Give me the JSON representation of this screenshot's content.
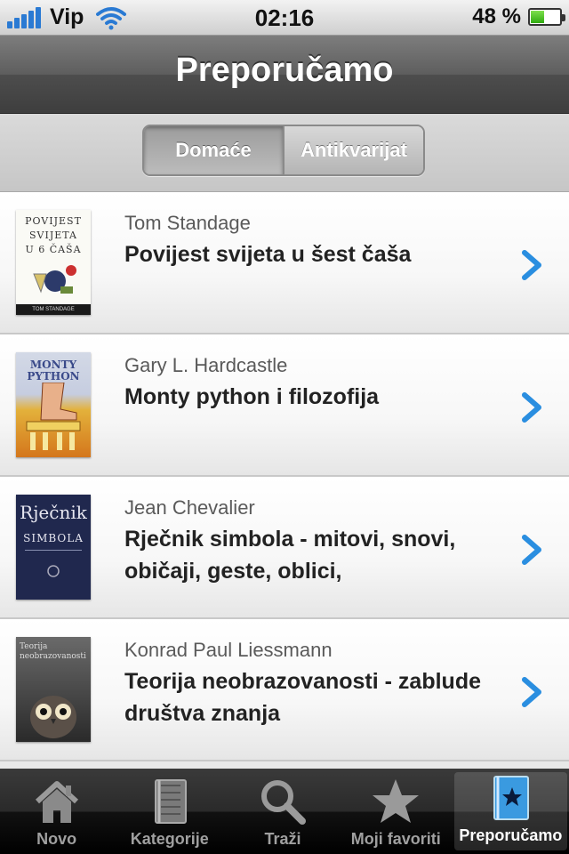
{
  "status_bar": {
    "carrier": "Vip",
    "time": "02:16",
    "battery": "48 %",
    "battery_level": 0.48
  },
  "nav": {
    "title": "Preporučamo"
  },
  "segments": {
    "items": [
      "Domaće",
      "Antikvarijat"
    ],
    "selected": 0
  },
  "books": [
    {
      "author": "Tom Standage",
      "title": "Povijest svijeta u šest čaša",
      "cover_lines": [
        "POVIJEST",
        "SVIJETA",
        "U 6 ČAŠA"
      ],
      "cover_byline": "TOM STANDAGE"
    },
    {
      "author": "Gary L. Hardcastle",
      "title": "Monty python i filozofija",
      "cover_lines": [
        "MONTY",
        "PYTHON"
      ],
      "cover_byline": ""
    },
    {
      "author": "Jean Chevalier",
      "title": "Rječnik simbola - mitovi, snovi, običaji, geste, oblici,",
      "cover_lines": [
        "Rječnik",
        "SIMBOLA"
      ],
      "cover_byline": ""
    },
    {
      "author": "Konrad Paul Liessmann",
      "title": "Teorija neobrazovanosti - zablude društva znanja",
      "cover_lines": [
        "Teorija",
        "neobrazovanosti"
      ],
      "cover_byline": ""
    }
  ],
  "tabs": [
    {
      "label": "Novo",
      "icon": "home-icon"
    },
    {
      "label": "Kategorije",
      "icon": "notebook-icon"
    },
    {
      "label": "Traži",
      "icon": "search-icon"
    },
    {
      "label": "Moji favoriti",
      "icon": "star-icon"
    },
    {
      "label": "Preporučamo",
      "icon": "recommend-book-icon"
    }
  ],
  "active_tab": 4,
  "colors": {
    "chevron": "#2a8ee0",
    "signal": "#2a7ad3",
    "battery": "#3fbf1a"
  }
}
